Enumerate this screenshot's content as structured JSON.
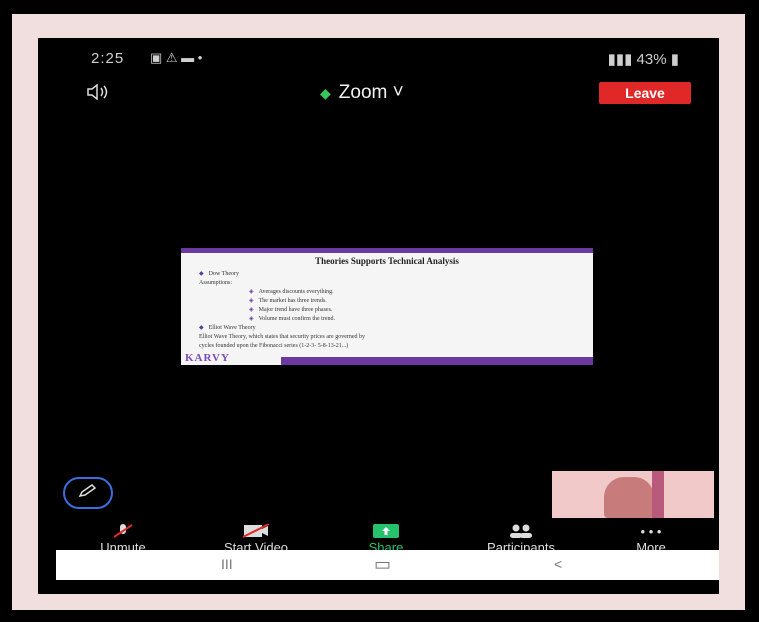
{
  "statusbar": {
    "time": "2:25",
    "icons": "▣ ⚠ ▬ •",
    "right": "43%"
  },
  "topbar": {
    "title": "Zoom",
    "leave_label": "Leave"
  },
  "slide": {
    "title": "Theories Supports Technical Analysis",
    "items": [
      {
        "text": "Dow Theory",
        "level": 1
      },
      {
        "text": "Assumptions:",
        "level": 0
      },
      {
        "text": "Averages discounts everything.",
        "level": 2
      },
      {
        "text": "The market has three trends.",
        "level": 2
      },
      {
        "text": "Major trend have three phases.",
        "level": 2
      },
      {
        "text": "Volume must confirm the trend.",
        "level": 2
      },
      {
        "text": "Elliot Wave Theory",
        "level": 1
      },
      {
        "text": "Elliot Wave Theory, which states that security prices are governed by",
        "level": 0
      },
      {
        "text": "cycles founded upon the Fibonacci series (1-2-3- 5-8-13-21...)",
        "level": 0
      }
    ],
    "logo": "KARVY"
  },
  "toolbar": {
    "unmute": "Unmute",
    "start_video": "Start Video",
    "share": "Share",
    "participants": "Participants",
    "more": "More"
  },
  "navbar": {
    "recents": "III",
    "home": "▭",
    "back": "<"
  },
  "colors": {
    "leave": "#e02828",
    "share": "#26c36c",
    "annotate": "#3b6fe0",
    "slide_accent": "#6b3aa0"
  }
}
